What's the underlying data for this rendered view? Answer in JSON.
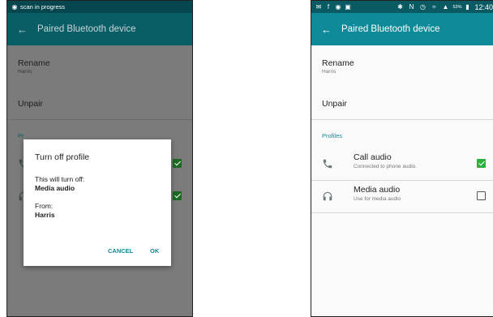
{
  "left_screen": {
    "status_bar": {
      "text": "scan in progress"
    },
    "app_bar": {
      "title": "Paired Bluetooth device"
    },
    "rename": {
      "label": "Rename",
      "device_name": "Harris"
    },
    "unpair": {
      "label": "Unpair"
    },
    "section_label": "Pr",
    "dialog": {
      "title": "Turn off profile",
      "line1": "This will turn off:",
      "line2": "Media audio",
      "line3": "From:",
      "line4": "Harris",
      "cancel_label": "CANCEL",
      "ok_label": "OK"
    }
  },
  "right_screen": {
    "status_bar": {
      "battery": "53%",
      "time": "12:40"
    },
    "app_bar": {
      "title": "Paired Bluetooth device"
    },
    "rename": {
      "label": "Rename",
      "device_name": "Harris"
    },
    "unpair": {
      "label": "Unpair"
    },
    "profiles": {
      "section_label": "Profiles",
      "items": [
        {
          "title": "Call audio",
          "subtitle": "Connected to phone audio.",
          "icon": "phone-icon",
          "checked": true
        },
        {
          "title": "Media audio",
          "subtitle": "Use for media audio",
          "icon": "headphones-icon",
          "checked": false
        }
      ]
    }
  },
  "colors": {
    "accent": "#0f8a98",
    "checked": "#2eaf3e",
    "statusbar": "#0a5a64"
  }
}
